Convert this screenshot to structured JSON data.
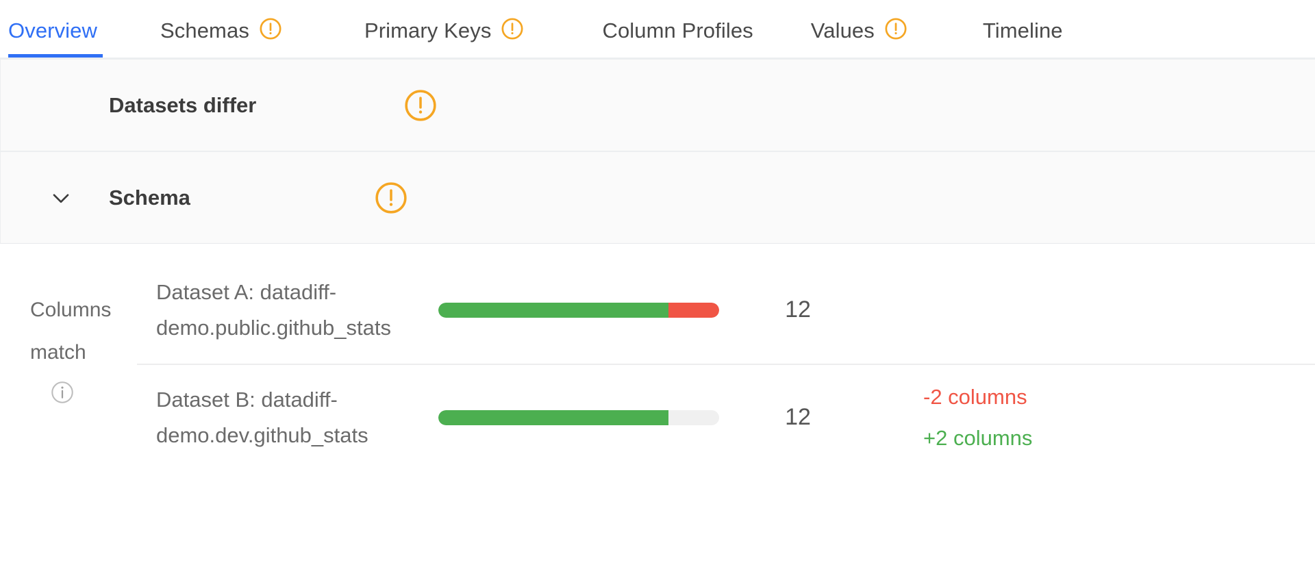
{
  "tabs": [
    {
      "label": "Overview",
      "active": true,
      "warning": false,
      "name": "tab-overview"
    },
    {
      "label": "Schemas",
      "active": false,
      "warning": true,
      "name": "tab-schemas"
    },
    {
      "label": "Primary Keys",
      "active": false,
      "warning": true,
      "name": "tab-primary-keys"
    },
    {
      "label": "Column Profiles",
      "active": false,
      "warning": false,
      "name": "tab-column-profiles"
    },
    {
      "label": "Values",
      "active": false,
      "warning": true,
      "name": "tab-values"
    },
    {
      "label": "Timeline",
      "active": false,
      "warning": false,
      "name": "tab-timeline"
    }
  ],
  "summary": {
    "datasets_differ": {
      "label": "Datasets differ",
      "warning_icon": "circle-exclamation-icon"
    },
    "schema": {
      "label": "Schema",
      "warning_icon": "circle-exclamation-icon",
      "chevron_icon": "chevron-down-icon",
      "expanded": true
    }
  },
  "metric": {
    "name_line1": "Columns",
    "name_line2": "match",
    "info_icon": "info-circle-icon",
    "rows": [
      {
        "dataset_line1": "Dataset A: datadiff-",
        "dataset_line2": "demo.public.github_stats",
        "count": "12",
        "bar": {
          "green_pct": 82,
          "red_pct": 18,
          "empty_pct": 0
        },
        "deltas": []
      },
      {
        "dataset_line1": "Dataset B: datadiff-",
        "dataset_line2": "demo.dev.github_stats",
        "count": "12",
        "bar": {
          "green_pct": 82,
          "red_pct": 0,
          "empty_pct": 18
        },
        "deltas": [
          {
            "text": "-2 columns",
            "kind": "negative"
          },
          {
            "text": "+2 columns",
            "kind": "positive"
          }
        ]
      }
    ]
  },
  "colors": {
    "accent_blue": "#2f6ff5",
    "warning_orange": "#f5a623",
    "green": "#4caf50",
    "red": "#f05545",
    "text_gray": "#6b6b6b",
    "row_bg": "#fafafa"
  }
}
